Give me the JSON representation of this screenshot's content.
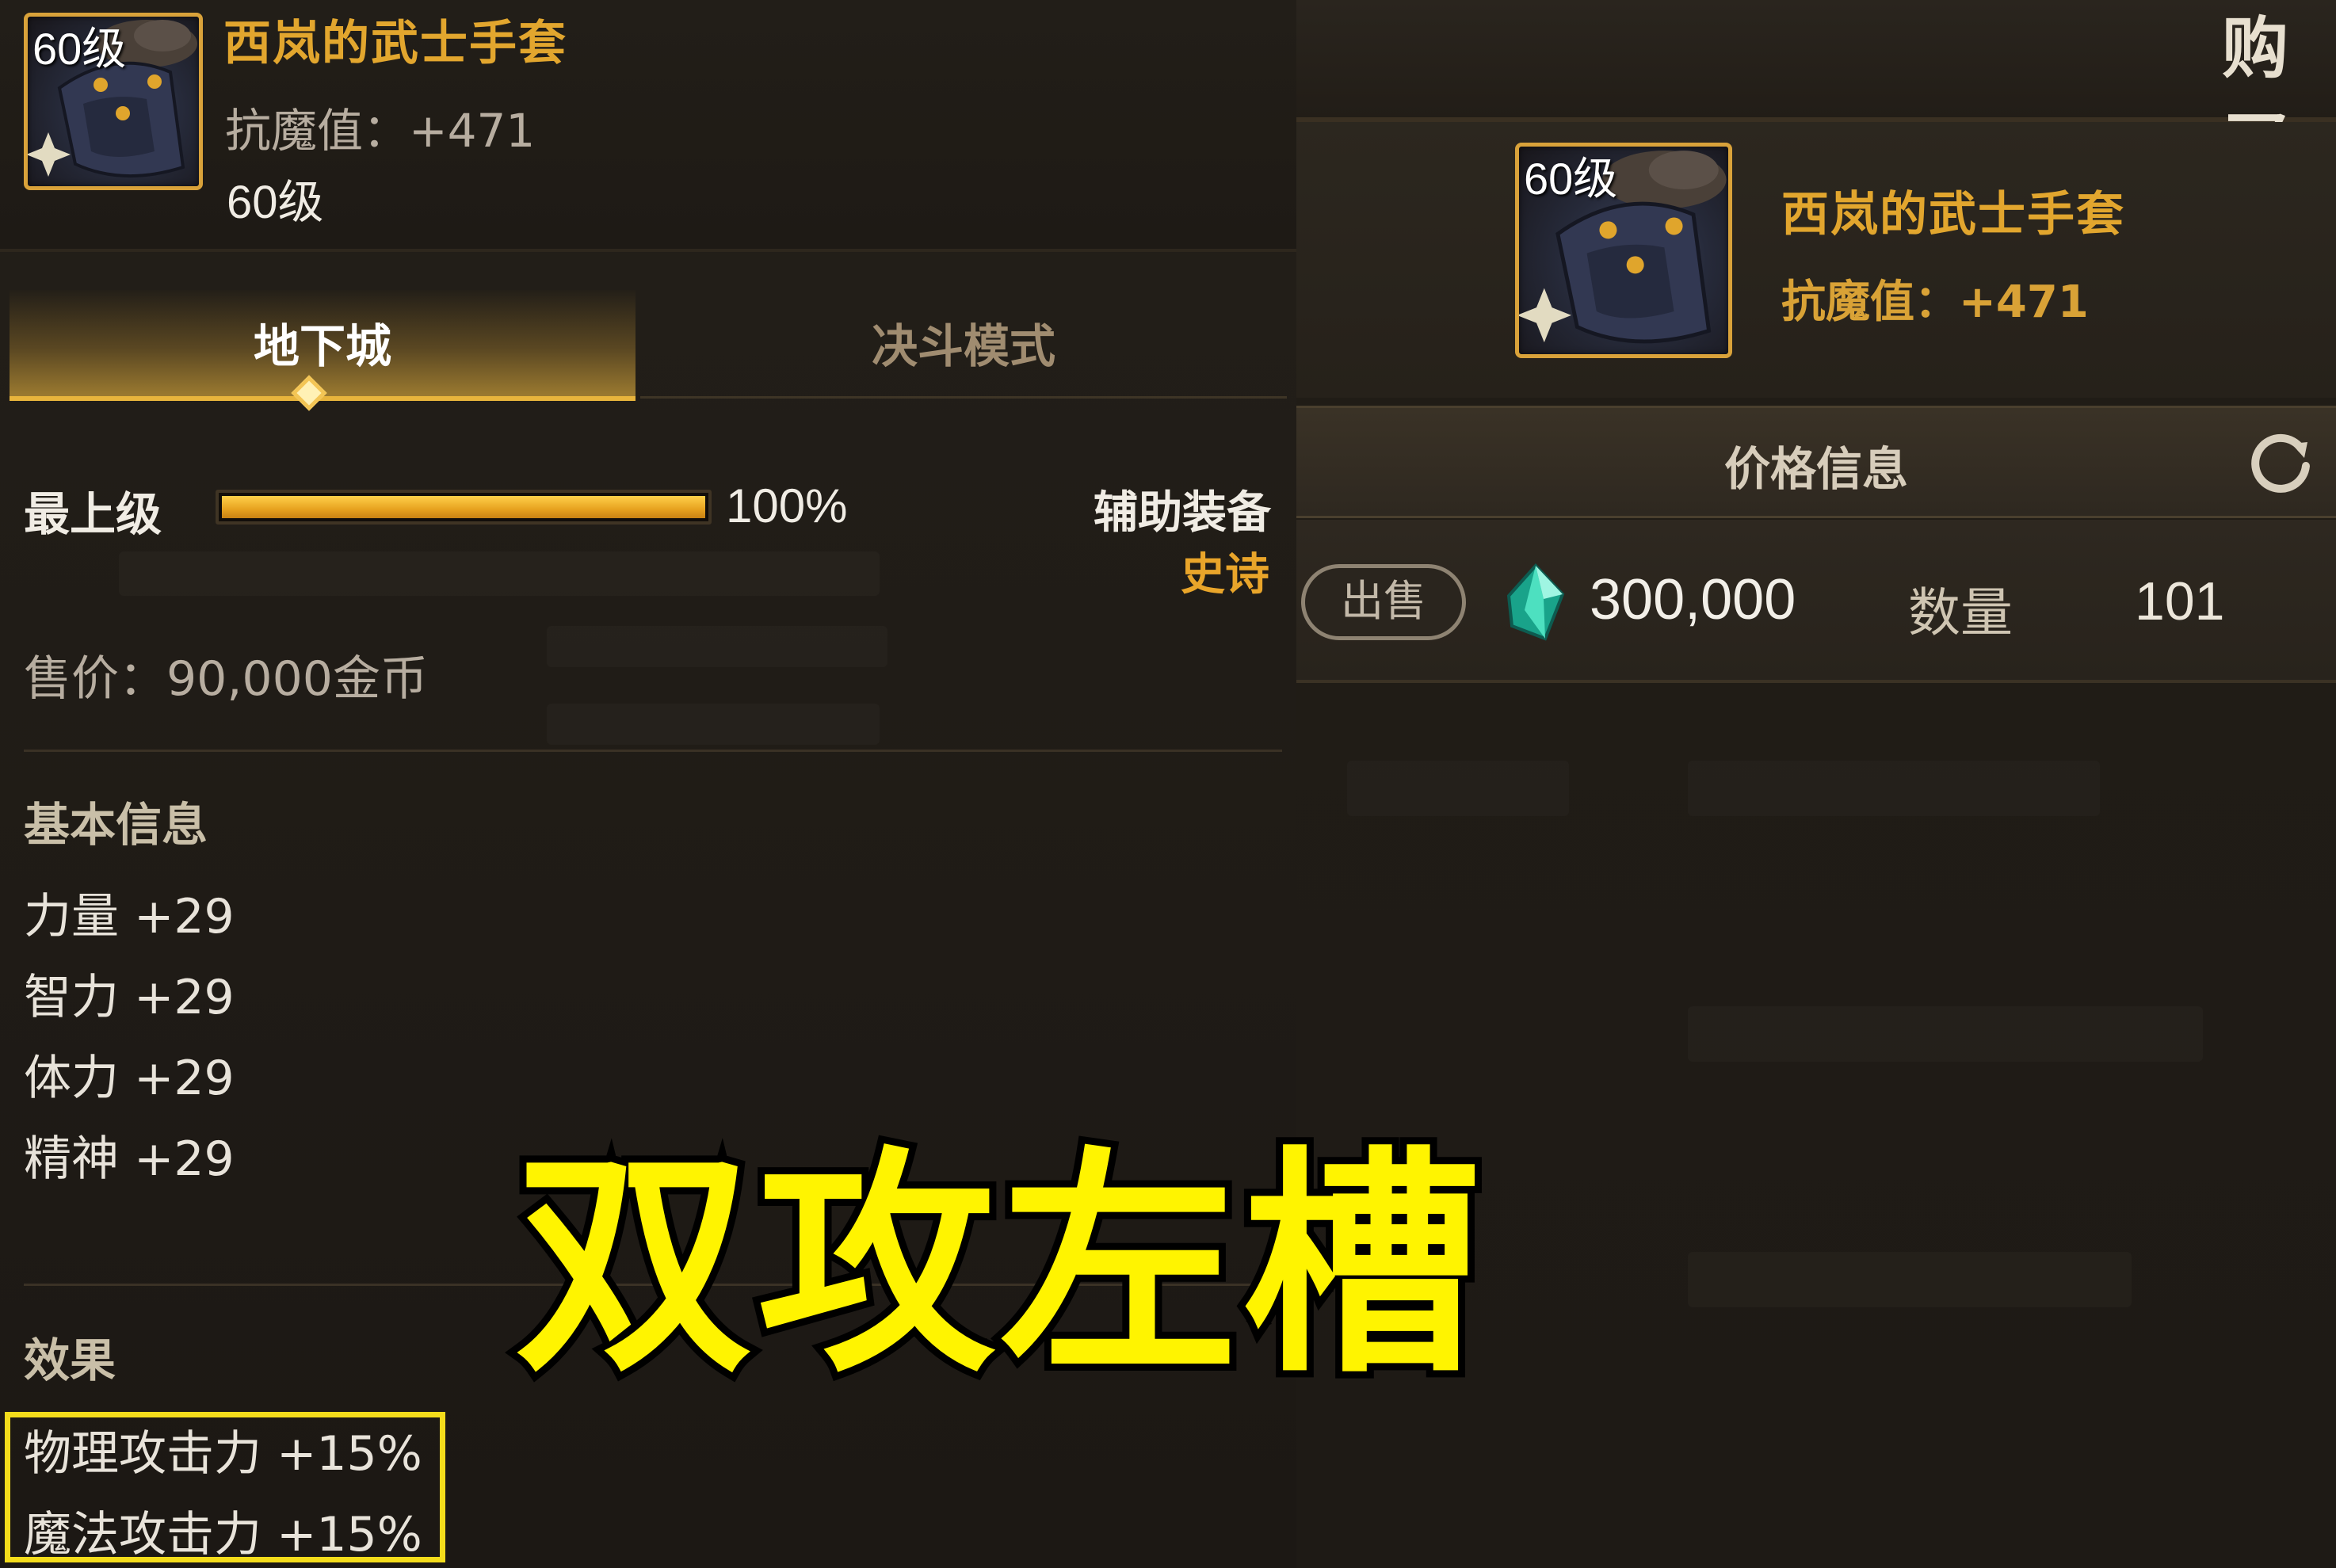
{
  "left_item": {
    "icon_level": "60级",
    "name": "西岚的武士手套",
    "magic_resist": "抗魔值：+471",
    "level": "60级"
  },
  "tabs": [
    {
      "label": "地下城"
    },
    {
      "label": "决斗模式"
    }
  ],
  "grade": {
    "label": "最上级",
    "percent": 100,
    "percent_text": "100%"
  },
  "equip_type": "辅助装备",
  "rarity": "史诗",
  "sell_price": "售价：90,000金币",
  "basic_info": {
    "title": "基本信息",
    "stats": [
      "力量 +29",
      "智力 +29",
      "体力 +29",
      "精神 +29"
    ]
  },
  "effects": {
    "title": "效果",
    "items": [
      "物理攻击力 +15%",
      "魔法攻击力 +15%"
    ]
  },
  "caption": "双攻左槽",
  "right": {
    "title": "购买",
    "item": {
      "icon_level": "60级",
      "name": "西岚的武士手套",
      "magic_resist": "抗魔值：+471"
    },
    "price_info_title": "价格信息",
    "listing": {
      "sell_label": "出售",
      "price": "300,000",
      "quantity_label": "数量",
      "quantity": "101"
    }
  },
  "colors": {
    "gold": "#e2a62e",
    "highlight_yellow": "#f4dc1b",
    "caption_yellow": "#fff400",
    "background": "#1d1913"
  }
}
